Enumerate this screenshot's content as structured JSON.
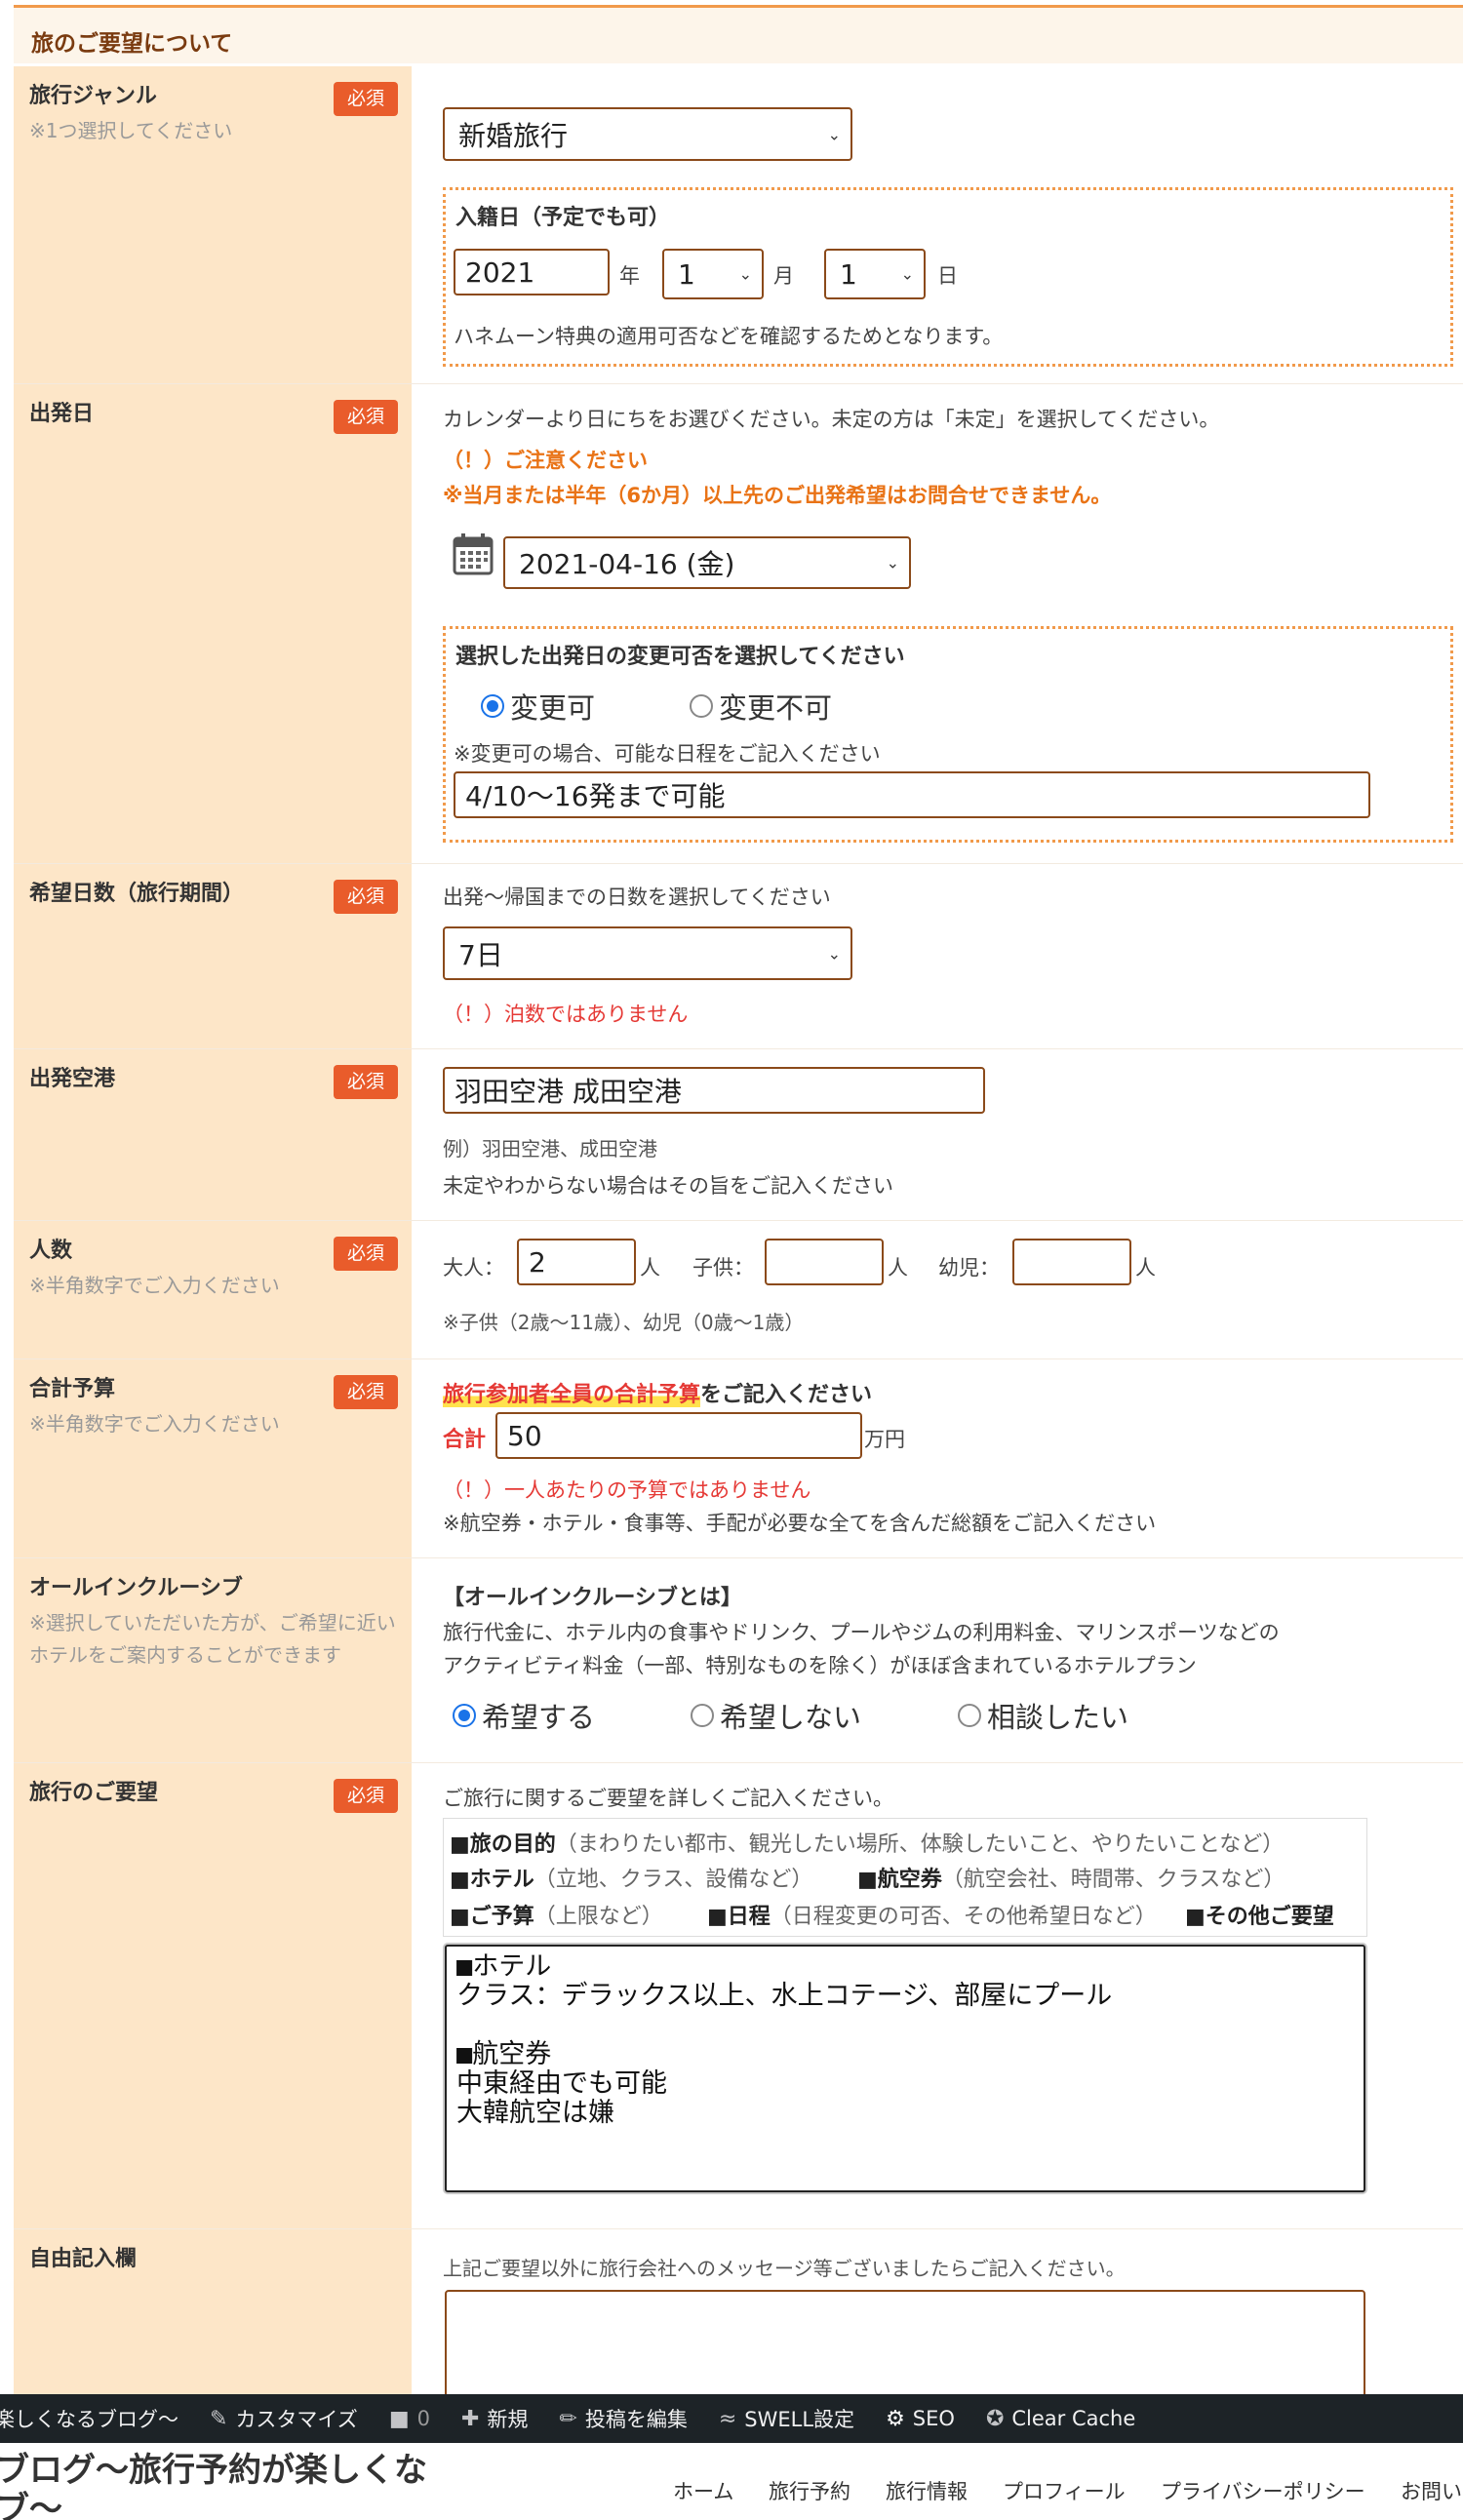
{
  "section_title": "旅のご要望について",
  "required_badge": "必須",
  "genre": {
    "label": "旅行ジャンル",
    "note": "※1つ選択してください",
    "selected": "新婚旅行",
    "entry_title": "入籍日（予定でも可）",
    "year": "2021",
    "year_unit": "年",
    "month": "1",
    "month_unit": "月",
    "day": "1",
    "day_unit": "日",
    "entry_note": "ハネムーン特典の適用可否などを確認するためとなります。"
  },
  "departure": {
    "label": "出発日",
    "desc": "カレンダーより日にちをお選びください。未定の方は「未定」を選択してください。",
    "warn_title": "（！）ご注意ください",
    "warn_text": "※当月または半年（6か月）以上先のご出発希望はお問合せできません。",
    "date": "2021-04-16 (金)",
    "change_title": "選択した出発日の変更可否を選択してください",
    "opt_yes": "変更可",
    "opt_no": "変更不可",
    "change_note": "※変更可の場合、可能な日程をご記入ください",
    "change_value": "4/10〜16発まで可能"
  },
  "days": {
    "label": "希望日数（旅行期間）",
    "desc": "出発〜帰国までの日数を選択してください",
    "selected": "7日",
    "warn": "（！）泊数ではありません"
  },
  "airport": {
    "label": "出発空港",
    "value": "羽田空港 成田空港",
    "example": "例）羽田空港、成田空港",
    "note": "未定やわからない場合はその旨をご記入ください"
  },
  "people": {
    "label": "人数",
    "note": "※半角数字でご入力ください",
    "adult_label": "大人：",
    "adult_value": "2",
    "adult_unit": "人",
    "child_label": "子供：",
    "child_unit": "人",
    "infant_label": "幼児：",
    "infant_unit": "人",
    "age_note": "※子供（2歳〜11歳）、幼児（0歳〜1歳）"
  },
  "budget": {
    "label": "合計予算",
    "note": "※半角数字でご入力ください",
    "head_highlight": "旅行参加者全員の合計予算",
    "head_rest": "をご記入ください",
    "total_label": "合計",
    "value": "50",
    "unit": "万円",
    "warn": "（！）一人あたりの予算ではありません",
    "note2": "※航空券・ホテル・食事等、手配が必要な全てを含んだ総額をご記入ください"
  },
  "allinc": {
    "label": "オールインクルーシブ",
    "note": "※選択していただいた方が、ご希望に近いホテルをご案内することができます",
    "head": "【オールインクルーシブとは】",
    "desc1": "旅行代金に、ホテル内の食事やドリンク、プールやジムの利用料金、マリンスポーツなどの",
    "desc2": "アクティビティ料金（一部、特別なものを除く）がほぼ含まれているホテルプラン",
    "opt1": "希望する",
    "opt2": "希望しない",
    "opt3": "相談したい"
  },
  "request": {
    "label": "旅行のご要望",
    "desc": "ご旅行に関するご要望を詳しくご記入ください。",
    "h1_b": "■旅の目的",
    "h1_s": "（まわりたい都市、観光したい場所、体験したいこと、やりたいことなど）",
    "h2a_b": "■ホテル",
    "h2a_s": "（立地、クラス、設備など）",
    "h2b_b": "■航空券",
    "h2b_s": "（航空会社、時間帯、クラスなど）",
    "h3a_b": "■ご予算",
    "h3a_s": "（上限など）",
    "h3b_b": "■日程",
    "h3b_s": "（日程変更の可否、その他希望日など）",
    "h3c_b": "■その他ご要望",
    "text": "■ホテル\nクラス：デラックス以上、水上コテージ、部屋にプール\n\n■航空券\n中東経由でも可能\n大韓航空は嫌"
  },
  "free": {
    "label": "自由記入欄",
    "desc": "上記ご要望以外に旅行会社へのメッセージ等ございましたらご記入ください。"
  },
  "adminbar": {
    "site": "楽しくなるブログ〜",
    "customize": "カスタマイズ",
    "comments": "0",
    "new": "新規",
    "edit": "投稿を編集",
    "swell": "SWELL設定",
    "seo": "SEO",
    "cache": "Clear Cache"
  },
  "site": {
    "title1": "ブログ〜旅行予約が楽しくな",
    "title2": "ブ〜",
    "nav": [
      "ホーム",
      "旅行予約",
      "旅行情報",
      "プロフィール",
      "プライバシーポリシー",
      "お問い"
    ]
  }
}
